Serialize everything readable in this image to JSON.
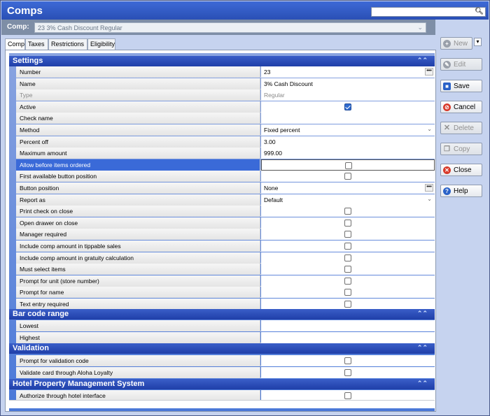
{
  "window": {
    "title": "Comps"
  },
  "comp_selector": {
    "label": "Comp:",
    "value": "23 3% Cash Discount Regular"
  },
  "tabs": [
    {
      "label": "Comp",
      "active": true
    },
    {
      "label": "Taxes",
      "active": false
    },
    {
      "label": "Restrictions",
      "active": false
    },
    {
      "label": "Eligibility",
      "active": false
    }
  ],
  "sections": {
    "settings": {
      "title": "Settings",
      "rows": [
        {
          "name": "Number",
          "value": "23"
        },
        {
          "name": "Name",
          "value": "3% Cash Discount"
        },
        {
          "name": "Type",
          "value": "Regular"
        },
        {
          "name": "Active",
          "value": "",
          "checked": true
        },
        {
          "name": "Check name",
          "value": ""
        },
        {
          "name": "Method",
          "value": "Fixed percent"
        },
        {
          "name": "Percent off",
          "value": "3.00"
        },
        {
          "name": "Maximum amount",
          "value": "999.00"
        },
        {
          "name": "Allow before items ordered",
          "value": "",
          "checked": false
        },
        {
          "name": "First available button position",
          "value": "",
          "checked": false
        },
        {
          "name": "Button position",
          "value": "None"
        },
        {
          "name": "Report as",
          "value": "Default"
        },
        {
          "name": "Print check on close",
          "value": "",
          "checked": false
        },
        {
          "name": "Open drawer on close",
          "value": "",
          "checked": false
        },
        {
          "name": "Manager required",
          "value": "",
          "checked": false
        },
        {
          "name": "Include comp amount in tippable sales",
          "value": "",
          "checked": false
        },
        {
          "name": "Include comp amount in gratuity calculation",
          "value": "",
          "checked": false
        },
        {
          "name": "Must select items",
          "value": "",
          "checked": false
        },
        {
          "name": "Prompt for unit (store number)",
          "value": "",
          "checked": false
        },
        {
          "name": "Prompt for name",
          "value": "",
          "checked": false
        },
        {
          "name": "Text entry required",
          "value": "",
          "checked": false
        }
      ]
    },
    "barcode": {
      "title": "Bar code range",
      "rows": [
        {
          "name": "Lowest",
          "value": ""
        },
        {
          "name": "Highest",
          "value": ""
        }
      ]
    },
    "validation": {
      "title": "Validation",
      "rows": [
        {
          "name": "Prompt for validation code",
          "checked": false
        },
        {
          "name": "Validate card through Aloha Loyalty",
          "checked": false
        }
      ]
    },
    "hotel": {
      "title": "Hotel Property Management System",
      "rows": [
        {
          "name": "Authorize through hotel interface",
          "checked": false
        }
      ]
    }
  },
  "sidebar": {
    "new": "New",
    "edit": "Edit",
    "save": "Save",
    "cancel": "Cancel",
    "delete": "Delete",
    "copy": "Copy",
    "close": "Close",
    "help": "Help"
  },
  "colors": {
    "accent": "#2a4fb5",
    "cancel": "#d83a2a",
    "help": "#2a62c8"
  }
}
